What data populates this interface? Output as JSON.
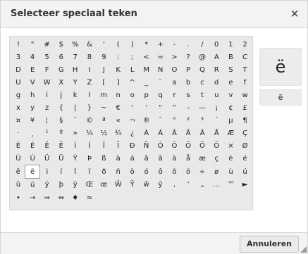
{
  "dialog": {
    "title": "Selecteer speciaal teken",
    "close_symbol": "×",
    "cancel_label": "Annuleren",
    "preview_large": "ë",
    "preview_small": "ë",
    "selected_char": "ë"
  },
  "char_grid": [
    [
      "!",
      "\"",
      "#",
      "$",
      "%",
      "&",
      "'",
      "(",
      ")",
      "*",
      "+",
      "-",
      ".",
      "/",
      "0",
      "1",
      "2"
    ],
    [
      "3",
      "4",
      "5",
      "6",
      "7",
      "8",
      "9",
      ":",
      ";",
      "<",
      "=",
      ">",
      "?",
      "@",
      "A",
      "B",
      "C"
    ],
    [
      "D",
      "E",
      "F",
      "G",
      "H",
      "I",
      "J",
      "K",
      "L",
      "M",
      "N",
      "O",
      "P",
      "Q",
      "R",
      "S",
      "T"
    ],
    [
      "U",
      "V",
      "W",
      "X",
      "Y",
      "Z",
      "[",
      "]",
      "^",
      "_",
      "`",
      "a",
      "b",
      "c",
      "d",
      "e",
      "f"
    ],
    [
      "g",
      "h",
      "i",
      "j",
      "k",
      "l",
      "m",
      "n",
      "o",
      "p",
      "q",
      "r",
      "s",
      "t",
      "u",
      "v",
      "w"
    ],
    [
      "x",
      "y",
      "z",
      "{",
      "|",
      "}",
      "~",
      "€",
      "‘",
      "’",
      "“",
      "”",
      "–",
      "—",
      "¡",
      "¢",
      "£"
    ],
    [
      "¤",
      "¥",
      "¦",
      "§",
      "¨",
      "©",
      "ª",
      "«",
      "¬",
      "®",
      "¯",
      "°",
      "²",
      "³",
      "´",
      "µ",
      "¶"
    ],
    [
      "·",
      "¸",
      "¹",
      "º",
      "»",
      "¼",
      "½",
      "¾",
      "¿",
      "À",
      "Á",
      "Â",
      "Ã",
      "Ä",
      "Å",
      "Æ",
      "Ç"
    ],
    [
      "È",
      "É",
      "Ê",
      "Ë",
      "Ì",
      "Í",
      "Î",
      "Ï",
      "Ð",
      "Ñ",
      "Ò",
      "Ó",
      "Ô",
      "Õ",
      "Ö",
      "×",
      "Ø"
    ],
    [
      "Ù",
      "Ú",
      "Û",
      "Ü",
      "Ý",
      "Þ",
      "ß",
      "à",
      "á",
      "â",
      "ã",
      "ä",
      "å",
      "æ",
      "ç",
      "è",
      "é"
    ],
    [
      "ê",
      "ë",
      "ì",
      "í",
      "î",
      "ï",
      "ð",
      "ñ",
      "ò",
      "ó",
      "ô",
      "õ",
      "ö",
      "÷",
      "ø",
      "ù",
      "ú"
    ],
    [
      "û",
      "ü",
      "ý",
      "þ",
      "ÿ",
      "Œ",
      "œ",
      "Ŵ",
      "Ŷ",
      "ŵ",
      "ŷ",
      "‚",
      "‛",
      "„",
      "…",
      "™",
      "►"
    ],
    [
      "•",
      "→",
      "⇒",
      "⇔",
      "♦",
      "≈",
      "",
      "",
      "",
      "",
      "",
      "",
      "",
      "",
      "",
      "",
      ""
    ]
  ]
}
